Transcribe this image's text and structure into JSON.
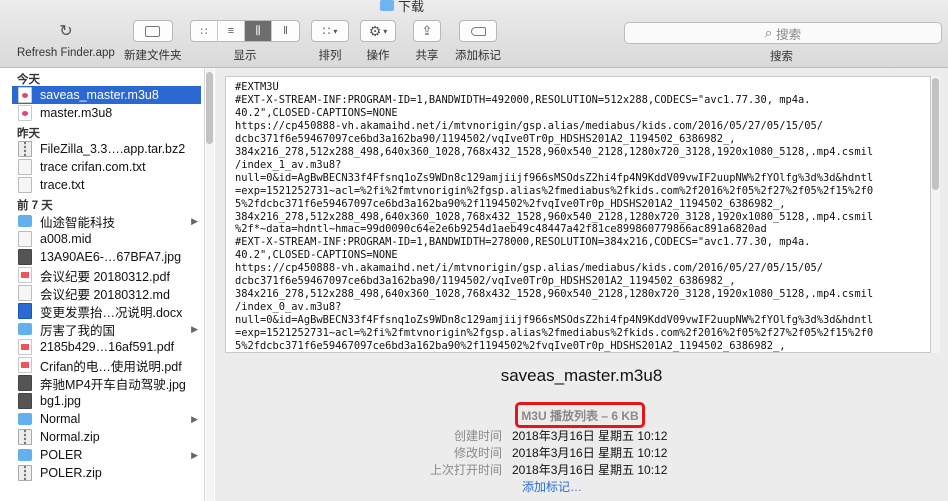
{
  "window_title": "下载",
  "toolbar": {
    "refresh": {
      "label": "Refresh Finder.app",
      "icon": "refresh-icon"
    },
    "new_folder": {
      "label": "新建文件夹",
      "icon": "new-folder-icon"
    },
    "view": {
      "label": "显示",
      "modes": [
        "icon-view",
        "list-view",
        "column-view",
        "gallery-view"
      ],
      "active_mode": "column-view"
    },
    "arrange": {
      "label": "排列"
    },
    "action": {
      "label": "操作"
    },
    "share": {
      "label": "共享"
    },
    "tag": {
      "label": "添加标记"
    },
    "search": {
      "placeholder": "搜索",
      "label": "搜索"
    }
  },
  "sidebar": {
    "sections": [
      {
        "title": "今天",
        "items": [
          {
            "name": "saveas_master.m3u8",
            "type": "m3u",
            "selected": true
          },
          {
            "name": "master.m3u8",
            "type": "m3u"
          }
        ]
      },
      {
        "title": "昨天",
        "items": [
          {
            "name": "FileZilla_3.3….app.tar.bz2",
            "type": "zip"
          },
          {
            "name": "trace crifan.com.txt",
            "type": "txt"
          },
          {
            "name": "trace.txt",
            "type": "txt"
          }
        ]
      },
      {
        "title": "前 7 天",
        "items": [
          {
            "name": "仙途智能科技",
            "type": "folder",
            "arrow": true
          },
          {
            "name": "a008.mid",
            "type": "txt"
          },
          {
            "name": "13A90AE6-…67BFA7.jpg",
            "type": "img"
          },
          {
            "name": "会议纪要 20180312.pdf",
            "type": "pdf"
          },
          {
            "name": "会议纪要 20180312.md",
            "type": "txt"
          },
          {
            "name": "变更发票抬…况说明.docx",
            "type": "doc"
          },
          {
            "name": "厉害了我的国",
            "type": "folder",
            "arrow": true
          },
          {
            "name": "2185b429…16af591.pdf",
            "type": "pdf"
          },
          {
            "name": "Crifan的电…使用说明.pdf",
            "type": "pdf"
          },
          {
            "name": "奔驰MP4开车自动驾驶.jpg",
            "type": "img"
          },
          {
            "name": "bg1.jpg",
            "type": "img"
          },
          {
            "name": "Normal",
            "type": "folder",
            "arrow": true
          },
          {
            "name": "Normal.zip",
            "type": "zip"
          },
          {
            "name": "POLER",
            "type": "folder",
            "arrow": true
          },
          {
            "name": "POLER.zip",
            "type": "zip"
          }
        ]
      }
    ]
  },
  "preview": {
    "content_lines": [
      "#EXTM3U",
      "#EXT-X-STREAM-INF:PROGRAM-ID=1,BANDWIDTH=492000,RESOLUTION=512x288,CODECS=\"avc1.77.30, mp4a.",
      "40.2\",CLOSED-CAPTIONS=NONE",
      "https://cp450888-vh.akamaihd.net/i/mtvnorigin/gsp.alias/mediabus/kids.com/2016/05/27/05/15/05/",
      "dcbc371f6e59467097ce6bd3a162ba90/1194502/vqIve0Tr0p_HDSHS201A2_1194502_6386982_,",
      "384x216_278,512x288_498,640x360_1028,768x432_1528,960x540_2128,1280x720_3128,1920x1080_5128,.mp4.csmil",
      "/index_1_av.m3u8?",
      "null=0&id=AgBwBECN33f4Ffsnq1oZs9WDn8c129amjiijf966sMSOdsZ2hi4fp4N9KddV09vwIF2uupNW%2fYOlfg%3d%3d&hdntl",
      "=exp=1521252731~acl=%2fi%2fmtvnorigin%2fgsp.alias%2fmediabus%2fkids.com%2f2016%2f05%2f27%2f05%2f15%2f0",
      "5%2fdcbc371f6e59467097ce6bd3a162ba90%2f1194502%2fvqIve0Tr0p_HDSHS201A2_1194502_6386982_,",
      "384x216_278,512x288_498,640x360_1028,768x432_1528,960x540_2128,1280x720_3128,1920x1080_5128,.mp4.csmil",
      "%2f*~data=hdntl~hmac=99d0090c64e2e6b9254d1aeb49c48447a42f81ce899860779866ac891a6820ad",
      "#EXT-X-STREAM-INF:PROGRAM-ID=1,BANDWIDTH=278000,RESOLUTION=384x216,CODECS=\"avc1.77.30, mp4a.",
      "40.2\",CLOSED-CAPTIONS=NONE",
      "https://cp450888-vh.akamaihd.net/i/mtvnorigin/gsp.alias/mediabus/kids.com/2016/05/27/05/15/05/",
      "dcbc371f6e59467097ce6bd3a162ba90/1194502/vqIve0Tr0p_HDSHS201A2_1194502_6386982_,",
      "384x216_278,512x288_498,640x360_1028,768x432_1528,960x540_2128,1280x720_3128,1920x1080_5128,.mp4.csmil",
      "/index_0_av.m3u8?",
      "null=0&id=AgBwBECN33f4Ffsnq1oZs9WDn8c129amjiijf966sMSOdsZ2hi4fp4N9KddV09vwIF2uupNW%2fYOlfg%3d%3d&hdntl",
      "=exp=1521252731~acl=%2fi%2fmtvnorigin%2fgsp.alias%2fmediabus%2fkids.com%2f2016%2f05%2f27%2f05%2f15%2f0",
      "5%2fdcbc371f6e59467097ce6bd3a162ba90%2f1194502%2fvqIve0Tr0p_HDSHS201A2_1194502_6386982_,"
    ],
    "filename": "saveas_master.m3u8",
    "kind": "M3U 播放列表 – 6 KB",
    "meta": [
      {
        "key": "创建时间",
        "value": "2018年3月16日 星期五 10:12"
      },
      {
        "key": "修改时间",
        "value": "2018年3月16日 星期五 10:12"
      },
      {
        "key": "上次打开时间",
        "value": "2018年3月16日 星期五 10:12"
      }
    ],
    "add_tags": "添加标记…"
  },
  "colors": {
    "selection": "#2a68d3",
    "highlight_box": "#e3161a",
    "link": "#2a6ed3"
  }
}
